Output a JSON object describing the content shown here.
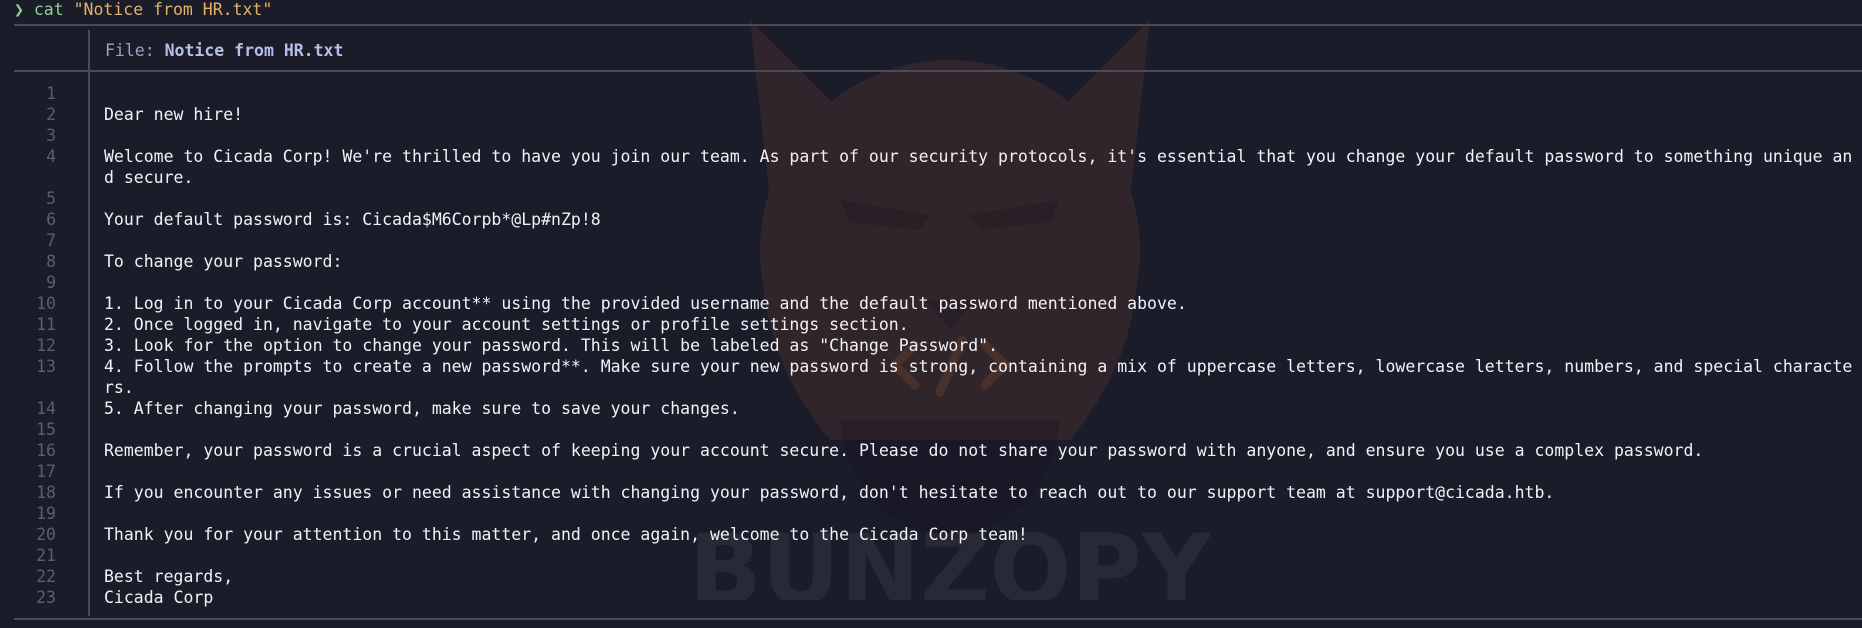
{
  "terminal": {
    "prompt_symbol": "❯",
    "command": "cat",
    "argument": "\"Notice from HR.txt\""
  },
  "viewer": {
    "file_label": "File:",
    "file_name": "Notice from HR.txt"
  },
  "watermark": {
    "text": "BUNZOPY"
  },
  "lines": [
    {
      "n": "1",
      "t": ""
    },
    {
      "n": "2",
      "t": "Dear new hire!"
    },
    {
      "n": "3",
      "t": ""
    },
    {
      "n": "4",
      "t": "Welcome to Cicada Corp! We're thrilled to have you join our team. As part of our security protocols, it's essential that you change your default password to something unique and secure."
    },
    {
      "n": "5",
      "t": ""
    },
    {
      "n": "6",
      "t": "Your default password is: Cicada$M6Corpb*@Lp#nZp!8"
    },
    {
      "n": "7",
      "t": ""
    },
    {
      "n": "8",
      "t": "To change your password:"
    },
    {
      "n": "9",
      "t": ""
    },
    {
      "n": "10",
      "t": "1. Log in to your Cicada Corp account** using the provided username and the default password mentioned above."
    },
    {
      "n": "11",
      "t": "2. Once logged in, navigate to your account settings or profile settings section."
    },
    {
      "n": "12",
      "t": "3. Look for the option to change your password. This will be labeled as \"Change Password\"."
    },
    {
      "n": "13",
      "t": "4. Follow the prompts to create a new password**. Make sure your new password is strong, containing a mix of uppercase letters, lowercase letters, numbers, and special characters."
    },
    {
      "n": "14",
      "t": "5. After changing your password, make sure to save your changes."
    },
    {
      "n": "15",
      "t": ""
    },
    {
      "n": "16",
      "t": "Remember, your password is a crucial aspect of keeping your account secure. Please do not share your password with anyone, and ensure you use a complex password."
    },
    {
      "n": "17",
      "t": ""
    },
    {
      "n": "18",
      "t": "If you encounter any issues or need assistance with changing your password, don't hesitate to reach out to our support team at support@cicada.htb."
    },
    {
      "n": "19",
      "t": ""
    },
    {
      "n": "20",
      "t": "Thank you for your attention to this matter, and once again, welcome to the Cicada Corp team!"
    },
    {
      "n": "21",
      "t": ""
    },
    {
      "n": "22",
      "t": "Best regards,"
    },
    {
      "n": "23",
      "t": "Cicada Corp"
    }
  ]
}
